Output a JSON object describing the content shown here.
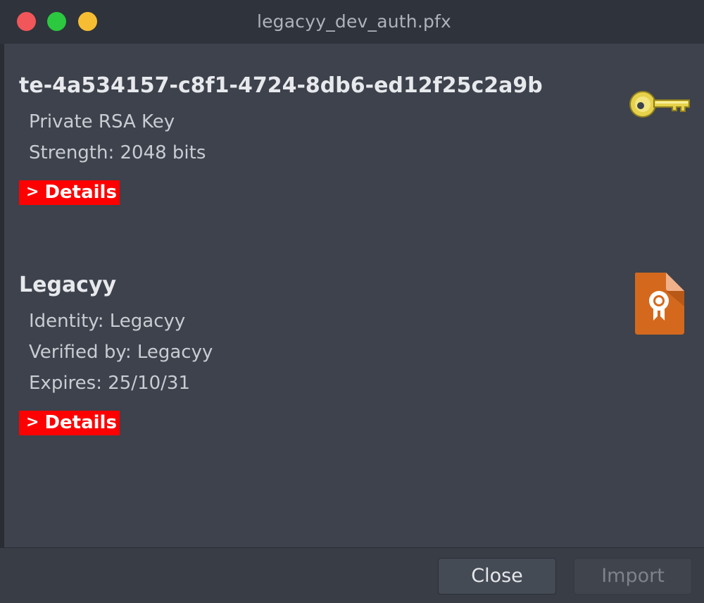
{
  "window": {
    "title": "legacyy_dev_auth.pfx"
  },
  "items": [
    {
      "title": "te-4a534157-c8f1-4724-8db6-ed12f25c2a9b",
      "lines": [
        "Private RSA Key",
        "Strength: 2048 bits"
      ],
      "details_label": "Details",
      "icon": "key-icon"
    },
    {
      "title": "Legacyy",
      "lines": [
        "Identity: Legacyy",
        "Verified by: Legacyy",
        "Expires: 25/10/31"
      ],
      "details_label": "Details",
      "icon": "certificate-icon"
    }
  ],
  "footer": {
    "close_label": "Close",
    "import_label": "Import"
  },
  "colors": {
    "details_bg": "#ff0000",
    "certificate": "#d4691e",
    "key": "#e6d24a"
  }
}
